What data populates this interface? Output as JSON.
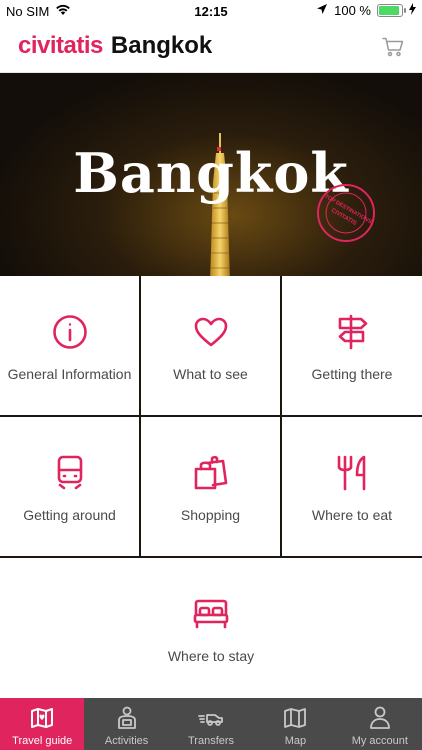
{
  "status_bar": {
    "carrier": "No SIM",
    "time": "12:15",
    "battery": "100 %"
  },
  "header": {
    "brand": "civitatis",
    "city": "Bangkok"
  },
  "hero": {
    "title": "Bangkok",
    "stamp_text": "TOP DESTINATIONS",
    "stamp_brand": "CIVITATIS"
  },
  "menu": {
    "items": [
      {
        "label": "General Information",
        "icon": "info-icon"
      },
      {
        "label": "What to see",
        "icon": "heart-icon"
      },
      {
        "label": "Getting there",
        "icon": "signpost-icon"
      },
      {
        "label": "Getting around",
        "icon": "train-icon"
      },
      {
        "label": "Shopping",
        "icon": "shopping-bags-icon"
      },
      {
        "label": "Where to eat",
        "icon": "fork-knife-icon"
      },
      {
        "label": "Where to stay",
        "icon": "bed-icon"
      }
    ]
  },
  "tabs": [
    {
      "label": "Travel guide",
      "icon": "map-book-icon",
      "active": true
    },
    {
      "label": "Activities",
      "icon": "guide-person-icon",
      "active": false
    },
    {
      "label": "Transfers",
      "icon": "car-transfer-icon",
      "active": false
    },
    {
      "label": "Map",
      "icon": "map-icon",
      "active": false
    },
    {
      "label": "My account",
      "icon": "user-icon",
      "active": false
    }
  ],
  "colors": {
    "accent": "#e0245e",
    "tabbar_bg": "#4a4a4a",
    "label_text": "#4a4a4a"
  }
}
